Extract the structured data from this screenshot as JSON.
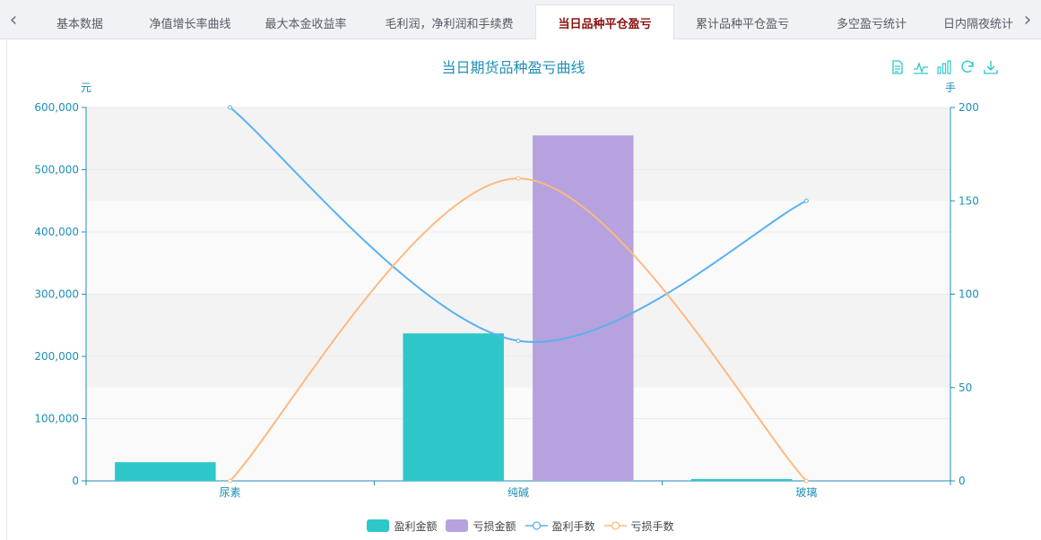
{
  "tabs": [
    {
      "label": "基本数据",
      "active": false
    },
    {
      "label": "净值增长率曲线",
      "active": false
    },
    {
      "label": "最大本金收益率",
      "active": false
    },
    {
      "label": "毛利润，净利润和手续费",
      "active": false
    },
    {
      "label": "当日品种平仓盈亏",
      "active": true
    },
    {
      "label": "累计品种平仓盈亏",
      "active": false
    },
    {
      "label": "多空盈亏统计",
      "active": false
    },
    {
      "label": "日内隔夜统计",
      "active": false
    }
  ],
  "toolbox": [
    {
      "name": "data-view-icon"
    },
    {
      "name": "line-chart-icon"
    },
    {
      "name": "bar-chart-icon"
    },
    {
      "name": "refresh-icon"
    },
    {
      "name": "download-icon"
    }
  ],
  "colors": {
    "accent": "#1f8fb6",
    "profit_bar": "#2ec7c9",
    "loss_bar": "#b6a2de",
    "profit_lots": "#5ab1ef",
    "loss_lots": "#ffb980",
    "tab_active": "#8b1111"
  },
  "chart_data": {
    "type": "bar",
    "title": "当日期货品种盈亏曲线",
    "categories": [
      "尿素",
      "纯碱",
      "玻璃"
    ],
    "y_left": {
      "unit": "元",
      "min": 0,
      "max": 600000,
      "interval": 100000,
      "tick_labels": [
        "0",
        "100,000",
        "200,000",
        "300,000",
        "400,000",
        "500,000",
        "600,000"
      ]
    },
    "y_right": {
      "unit": "手",
      "min": 0,
      "max": 200,
      "interval": 50,
      "tick_labels": [
        "0",
        "50",
        "100",
        "150",
        "200"
      ]
    },
    "series": [
      {
        "name": "盈利金额",
        "kind": "bar",
        "axis": "left",
        "values": [
          30000,
          237000,
          3000
        ]
      },
      {
        "name": "亏损金额",
        "kind": "bar",
        "axis": "left",
        "values": [
          0,
          555000,
          0
        ]
      },
      {
        "name": "盈利手数",
        "kind": "line",
        "axis": "right",
        "values": [
          200,
          75,
          150
        ]
      },
      {
        "name": "亏损手数",
        "kind": "line",
        "axis": "right",
        "values": [
          0,
          162,
          0
        ]
      }
    ],
    "legend_position": "bottom-center"
  }
}
